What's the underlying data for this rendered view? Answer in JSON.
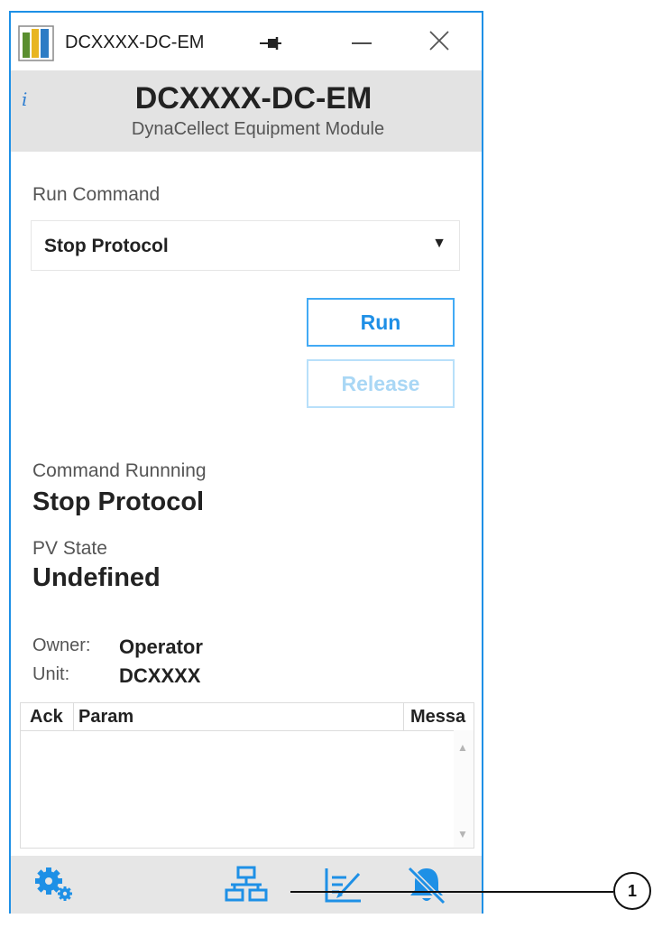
{
  "window": {
    "title": "DCXXXX-DC-EM",
    "pin_icon": "pin-icon",
    "minimize_icon": "minimize-icon",
    "close_icon": "close-icon"
  },
  "header": {
    "info_icon": "i",
    "title": "DCXXXX-DC-EM",
    "subtitle": "DynaCellect Equipment Module"
  },
  "run_command": {
    "label": "Run Command",
    "selected": "Stop Protocol",
    "arrow": "▼"
  },
  "buttons": {
    "run": "Run",
    "release": "Release"
  },
  "status": {
    "command_running_label": "Command Runnning",
    "command_running_value": "Stop Protocol",
    "pv_state_label": "PV State",
    "pv_state_value": "Undefined"
  },
  "info": {
    "owner_label": "Owner:",
    "owner_value": "Operator",
    "unit_label": "Unit:",
    "unit_value": "DCXXXX"
  },
  "grid": {
    "columns": [
      "Ack",
      "Param",
      "Messa"
    ]
  },
  "footer": {
    "icons": [
      "gears-icon",
      "network-icon",
      "edit-chart-icon",
      "bell-muted-icon"
    ]
  },
  "callout": {
    "number": "1"
  },
  "colors": {
    "accent": "#1e90e6",
    "header_bg": "#e3e3e3",
    "footer_bg": "#e6e6e6"
  }
}
